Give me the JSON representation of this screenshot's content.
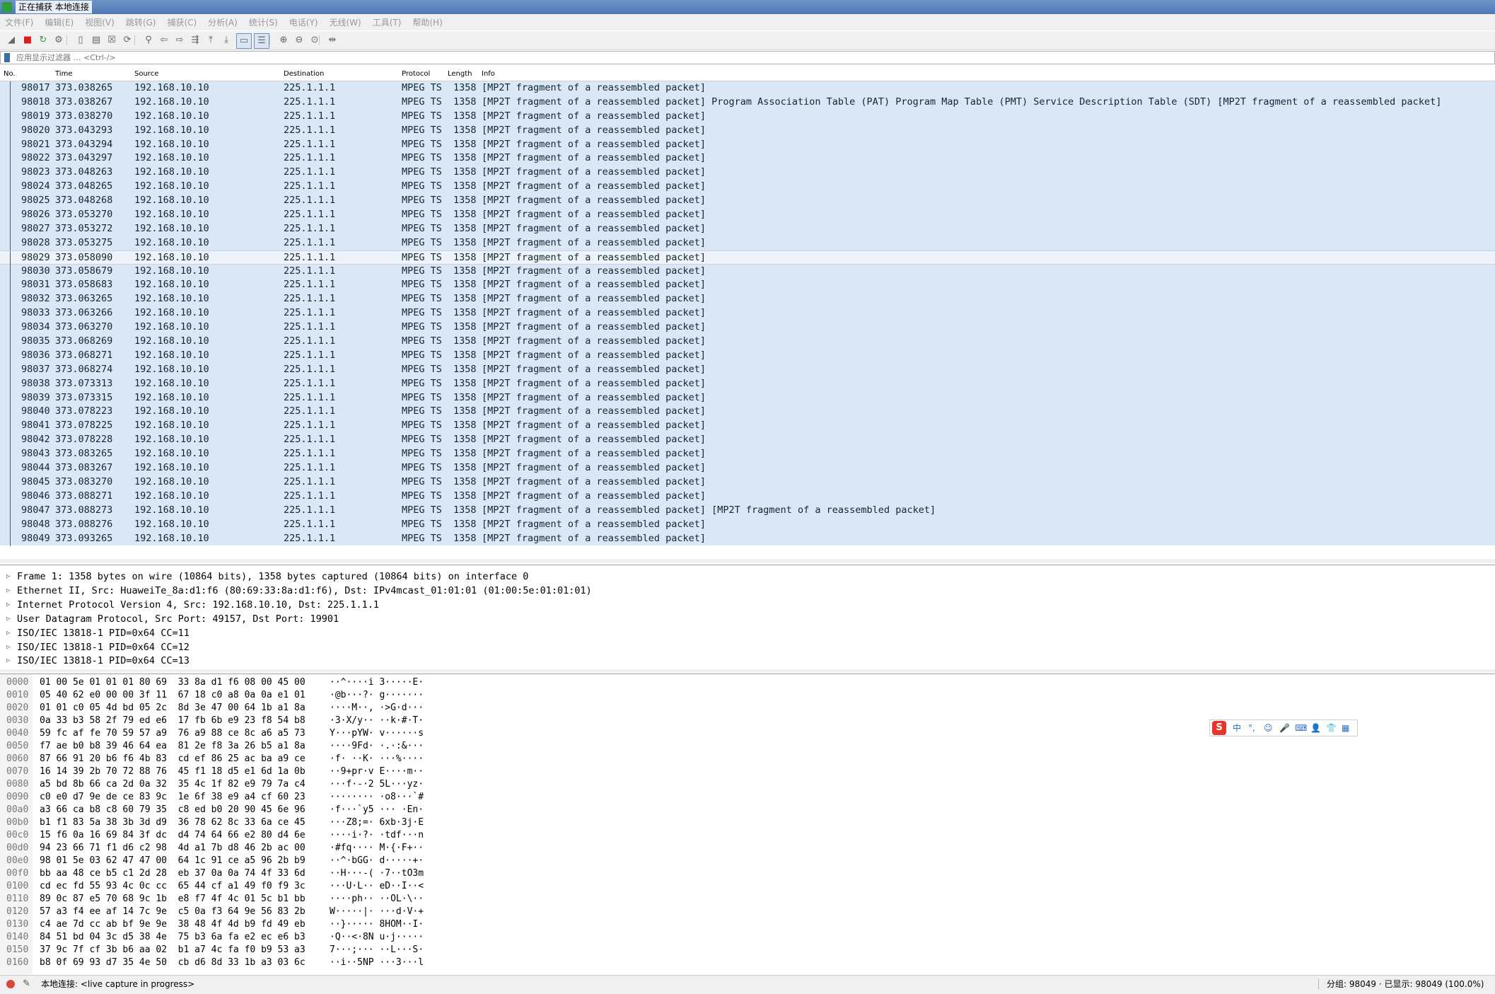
{
  "window": {
    "title": "正在捕获 本地连接"
  },
  "menu": [
    "文件(F)",
    "编辑(E)",
    "视图(V)",
    "跳转(G)",
    "捕获(C)",
    "分析(A)",
    "统计(S)",
    "电话(Y)",
    "无线(W)",
    "工具(T)",
    "帮助(H)"
  ],
  "toolbar": {
    "icons": [
      "shark-fin-start-icon",
      "stop-capture-icon",
      "restart-capture-icon",
      "capture-options-icon",
      "open-file-icon",
      "save-file-icon",
      "close-file-icon",
      "reload-file-icon",
      "find-packet-icon",
      "go-back-icon",
      "go-forward-icon",
      "go-to-packet-icon",
      "first-packet-icon",
      "last-packet-icon",
      "autoscroll-icon",
      "colorize-icon",
      "zoom-in-icon",
      "zoom-out-icon",
      "normal-size-icon",
      "resize-columns-icon"
    ],
    "glyphs": [
      "◢",
      "■",
      "↻",
      "⚙",
      "▯",
      "▤",
      "☒",
      "⟳",
      "⚲",
      "⇦",
      "⇨",
      "⇶",
      "⤒",
      "⤓",
      "▭",
      "☰",
      "⊕",
      "⊖",
      "⊙",
      "⇹"
    ]
  },
  "filter": {
    "placeholder": "应用显示过滤器 … <Ctrl-/>"
  },
  "columns": {
    "no": "No.",
    "time": "Time",
    "source": "Source",
    "destination": "Destination",
    "protocol": "Protocol",
    "length": "Length",
    "info": "Info"
  },
  "packets": [
    {
      "no": "98017",
      "time": "373.038265",
      "src": "192.168.10.10",
      "dst": "225.1.1.1",
      "proto": "MPEG TS",
      "len": "1358",
      "info": "[MP2T fragment of a reassembled packet]"
    },
    {
      "no": "98018",
      "time": "373.038267",
      "src": "192.168.10.10",
      "dst": "225.1.1.1",
      "proto": "MPEG TS",
      "len": "1358",
      "info": "[MP2T fragment of a reassembled packet] Program Association Table (PAT) Program Map Table (PMT) Service Description Table (SDT) [MP2T fragment of a reassembled packet]"
    },
    {
      "no": "98019",
      "time": "373.038270",
      "src": "192.168.10.10",
      "dst": "225.1.1.1",
      "proto": "MPEG TS",
      "len": "1358",
      "info": "[MP2T fragment of a reassembled packet]"
    },
    {
      "no": "98020",
      "time": "373.043293",
      "src": "192.168.10.10",
      "dst": "225.1.1.1",
      "proto": "MPEG TS",
      "len": "1358",
      "info": "[MP2T fragment of a reassembled packet]"
    },
    {
      "no": "98021",
      "time": "373.043294",
      "src": "192.168.10.10",
      "dst": "225.1.1.1",
      "proto": "MPEG TS",
      "len": "1358",
      "info": "[MP2T fragment of a reassembled packet]"
    },
    {
      "no": "98022",
      "time": "373.043297",
      "src": "192.168.10.10",
      "dst": "225.1.1.1",
      "proto": "MPEG TS",
      "len": "1358",
      "info": "[MP2T fragment of a reassembled packet]"
    },
    {
      "no": "98023",
      "time": "373.048263",
      "src": "192.168.10.10",
      "dst": "225.1.1.1",
      "proto": "MPEG TS",
      "len": "1358",
      "info": "[MP2T fragment of a reassembled packet]"
    },
    {
      "no": "98024",
      "time": "373.048265",
      "src": "192.168.10.10",
      "dst": "225.1.1.1",
      "proto": "MPEG TS",
      "len": "1358",
      "info": "[MP2T fragment of a reassembled packet]"
    },
    {
      "no": "98025",
      "time": "373.048268",
      "src": "192.168.10.10",
      "dst": "225.1.1.1",
      "proto": "MPEG TS",
      "len": "1358",
      "info": "[MP2T fragment of a reassembled packet]"
    },
    {
      "no": "98026",
      "time": "373.053270",
      "src": "192.168.10.10",
      "dst": "225.1.1.1",
      "proto": "MPEG TS",
      "len": "1358",
      "info": "[MP2T fragment of a reassembled packet]"
    },
    {
      "no": "98027",
      "time": "373.053272",
      "src": "192.168.10.10",
      "dst": "225.1.1.1",
      "proto": "MPEG TS",
      "len": "1358",
      "info": "[MP2T fragment of a reassembled packet]"
    },
    {
      "no": "98028",
      "time": "373.053275",
      "src": "192.168.10.10",
      "dst": "225.1.1.1",
      "proto": "MPEG TS",
      "len": "1358",
      "info": "[MP2T fragment of a reassembled packet]"
    },
    {
      "no": "98029",
      "time": "373.058090",
      "src": "192.168.10.10",
      "dst": "225.1.1.1",
      "proto": "MPEG TS",
      "len": "1358",
      "info": "[MP2T fragment of a reassembled packet]",
      "hover": true
    },
    {
      "no": "98030",
      "time": "373.058679",
      "src": "192.168.10.10",
      "dst": "225.1.1.1",
      "proto": "MPEG TS",
      "len": "1358",
      "info": "[MP2T fragment of a reassembled packet]"
    },
    {
      "no": "98031",
      "time": "373.058683",
      "src": "192.168.10.10",
      "dst": "225.1.1.1",
      "proto": "MPEG TS",
      "len": "1358",
      "info": "[MP2T fragment of a reassembled packet]"
    },
    {
      "no": "98032",
      "time": "373.063265",
      "src": "192.168.10.10",
      "dst": "225.1.1.1",
      "proto": "MPEG TS",
      "len": "1358",
      "info": "[MP2T fragment of a reassembled packet]"
    },
    {
      "no": "98033",
      "time": "373.063266",
      "src": "192.168.10.10",
      "dst": "225.1.1.1",
      "proto": "MPEG TS",
      "len": "1358",
      "info": "[MP2T fragment of a reassembled packet]"
    },
    {
      "no": "98034",
      "time": "373.063270",
      "src": "192.168.10.10",
      "dst": "225.1.1.1",
      "proto": "MPEG TS",
      "len": "1358",
      "info": "[MP2T fragment of a reassembled packet]"
    },
    {
      "no": "98035",
      "time": "373.068269",
      "src": "192.168.10.10",
      "dst": "225.1.1.1",
      "proto": "MPEG TS",
      "len": "1358",
      "info": "[MP2T fragment of a reassembled packet]"
    },
    {
      "no": "98036",
      "time": "373.068271",
      "src": "192.168.10.10",
      "dst": "225.1.1.1",
      "proto": "MPEG TS",
      "len": "1358",
      "info": "[MP2T fragment of a reassembled packet]"
    },
    {
      "no": "98037",
      "time": "373.068274",
      "src": "192.168.10.10",
      "dst": "225.1.1.1",
      "proto": "MPEG TS",
      "len": "1358",
      "info": "[MP2T fragment of a reassembled packet]"
    },
    {
      "no": "98038",
      "time": "373.073313",
      "src": "192.168.10.10",
      "dst": "225.1.1.1",
      "proto": "MPEG TS",
      "len": "1358",
      "info": "[MP2T fragment of a reassembled packet]"
    },
    {
      "no": "98039",
      "time": "373.073315",
      "src": "192.168.10.10",
      "dst": "225.1.1.1",
      "proto": "MPEG TS",
      "len": "1358",
      "info": "[MP2T fragment of a reassembled packet]"
    },
    {
      "no": "98040",
      "time": "373.078223",
      "src": "192.168.10.10",
      "dst": "225.1.1.1",
      "proto": "MPEG TS",
      "len": "1358",
      "info": "[MP2T fragment of a reassembled packet]"
    },
    {
      "no": "98041",
      "time": "373.078225",
      "src": "192.168.10.10",
      "dst": "225.1.1.1",
      "proto": "MPEG TS",
      "len": "1358",
      "info": "[MP2T fragment of a reassembled packet]"
    },
    {
      "no": "98042",
      "time": "373.078228",
      "src": "192.168.10.10",
      "dst": "225.1.1.1",
      "proto": "MPEG TS",
      "len": "1358",
      "info": "[MP2T fragment of a reassembled packet]"
    },
    {
      "no": "98043",
      "time": "373.083265",
      "src": "192.168.10.10",
      "dst": "225.1.1.1",
      "proto": "MPEG TS",
      "len": "1358",
      "info": "[MP2T fragment of a reassembled packet]"
    },
    {
      "no": "98044",
      "time": "373.083267",
      "src": "192.168.10.10",
      "dst": "225.1.1.1",
      "proto": "MPEG TS",
      "len": "1358",
      "info": "[MP2T fragment of a reassembled packet]"
    },
    {
      "no": "98045",
      "time": "373.083270",
      "src": "192.168.10.10",
      "dst": "225.1.1.1",
      "proto": "MPEG TS",
      "len": "1358",
      "info": "[MP2T fragment of a reassembled packet]"
    },
    {
      "no": "98046",
      "time": "373.088271",
      "src": "192.168.10.10",
      "dst": "225.1.1.1",
      "proto": "MPEG TS",
      "len": "1358",
      "info": "[MP2T fragment of a reassembled packet]"
    },
    {
      "no": "98047",
      "time": "373.088273",
      "src": "192.168.10.10",
      "dst": "225.1.1.1",
      "proto": "MPEG TS",
      "len": "1358",
      "info": "[MP2T fragment of a reassembled packet] [MP2T fragment of a reassembled packet]"
    },
    {
      "no": "98048",
      "time": "373.088276",
      "src": "192.168.10.10",
      "dst": "225.1.1.1",
      "proto": "MPEG TS",
      "len": "1358",
      "info": "[MP2T fragment of a reassembled packet]"
    },
    {
      "no": "98049",
      "time": "373.093265",
      "src": "192.168.10.10",
      "dst": "225.1.1.1",
      "proto": "MPEG TS",
      "len": "1358",
      "info": "[MP2T fragment of a reassembled packet]"
    }
  ],
  "details": [
    "Frame 1: 1358 bytes on wire (10864 bits), 1358 bytes captured (10864 bits) on interface 0",
    "Ethernet II, Src: HuaweiTe_8a:d1:f6 (80:69:33:8a:d1:f6), Dst: IPv4mcast_01:01:01 (01:00:5e:01:01:01)",
    "Internet Protocol Version 4, Src: 192.168.10.10, Dst: 225.1.1.1",
    "User Datagram Protocol, Src Port: 49157, Dst Port: 19901",
    "ISO/IEC 13818-1 PID=0x64 CC=11",
    "ISO/IEC 13818-1 PID=0x64 CC=12",
    "ISO/IEC 13818-1 PID=0x64 CC=13"
  ],
  "bytes": [
    {
      "off": "0000",
      "hex": "01 00 5e 01 01 01 80 69  33 8a d1 f6 08 00 45 00",
      "asc": "··^····i 3·····E·"
    },
    {
      "off": "0010",
      "hex": "05 40 62 e0 00 00 3f 11  67 18 c0 a8 0a 0a e1 01",
      "asc": "·@b···?· g·······"
    },
    {
      "off": "0020",
      "hex": "01 01 c0 05 4d bd 05 2c  8d 3e 47 00 64 1b a1 8a",
      "asc": "····M··, ·>G·d···"
    },
    {
      "off": "0030",
      "hex": "0a 33 b3 58 2f 79 ed e6  17 fb 6b e9 23 f8 54 b8",
      "asc": "·3·X/y·· ··k·#·T·"
    },
    {
      "off": "0040",
      "hex": "59 fc af fe 70 59 57 a9  76 a9 88 ce 8c a6 a5 73",
      "asc": "Y···pYW· v······s"
    },
    {
      "off": "0050",
      "hex": "f7 ae b0 b8 39 46 64 ea  81 2e f8 3a 26 b5 a1 8a",
      "asc": "····9Fd· ·.·:&···"
    },
    {
      "off": "0060",
      "hex": "87 66 91 20 b6 f6 4b 83  cd ef 86 25 ac ba a9 ce",
      "asc": "·f· ··K· ···%····"
    },
    {
      "off": "0070",
      "hex": "16 14 39 2b 70 72 88 76  45 f1 18 d5 e1 6d 1a 0b",
      "asc": "··9+pr·v E····m··"
    },
    {
      "off": "0080",
      "hex": "a5 bd 8b 66 ca 2d 0a 32  35 4c 1f 82 e9 79 7a c4",
      "asc": "···f·-·2 5L···yz·"
    },
    {
      "off": "0090",
      "hex": "c0 e0 d7 9e de ce 83 9c  1e 6f 38 e9 a4 cf 60 23",
      "asc": "········ ·o8···`#"
    },
    {
      "off": "00a0",
      "hex": "a3 66 ca b8 c8 60 79 35  c8 ed b0 20 90 45 6e 96",
      "asc": "·f···`y5 ··· ·En·"
    },
    {
      "off": "00b0",
      "hex": "b1 f1 83 5a 38 3b 3d d9  36 78 62 8c 33 6a ce 45",
      "asc": "···Z8;=· 6xb·3j·E"
    },
    {
      "off": "00c0",
      "hex": "15 f6 0a 16 69 84 3f dc  d4 74 64 66 e2 80 d4 6e",
      "asc": "····i·?· ·tdf···n"
    },
    {
      "off": "00d0",
      "hex": "94 23 66 71 f1 d6 c2 98  4d a1 7b d8 46 2b ac 00",
      "asc": "·#fq···· M·{·F+··"
    },
    {
      "off": "00e0",
      "hex": "98 01 5e 03 62 47 47 00  64 1c 91 ce a5 96 2b b9",
      "asc": "··^·bGG· d·····+·"
    },
    {
      "off": "00f0",
      "hex": "bb aa 48 ce b5 c1 2d 28  eb 37 0a 0a 74 4f 33 6d",
      "asc": "··H···-( ·7··tO3m"
    },
    {
      "off": "0100",
      "hex": "cd ec fd 55 93 4c 0c cc  65 44 cf a1 49 f0 f9 3c",
      "asc": "···U·L·· eD··I··<"
    },
    {
      "off": "0110",
      "hex": "89 0c 87 e5 70 68 9c 1b  e8 f7 4f 4c 01 5c b1 bb",
      "asc": "····ph·· ··OL·\\··"
    },
    {
      "off": "0120",
      "hex": "57 a3 f4 ee af 14 7c 9e  c5 0a f3 64 9e 56 83 2b",
      "asc": "W·····|· ···d·V·+"
    },
    {
      "off": "0130",
      "hex": "c4 ae 7d cc ab bf 9e 9e  38 48 4f 4d b9 fd 49 eb",
      "asc": "··}····· 8HOM··I·"
    },
    {
      "off": "0140",
      "hex": "84 51 bd 04 3c d5 38 4e  75 b3 6a fa e2 ec e6 b3",
      "asc": "·Q··<·8N u·j·····"
    },
    {
      "off": "0150",
      "hex": "37 9c 7f cf 3b b6 aa 02  b1 a7 4c fa f0 b9 53 a3",
      "asc": "7···;··· ··L···S·"
    },
    {
      "off": "0160",
      "hex": "b8 0f 69 93 d7 35 4e 50  cb d6 8d 33 1b a3 03 6c",
      "asc": "··i··5NP ···3···l"
    }
  ],
  "ime": {
    "logo": "S",
    "items": [
      "中",
      "°,",
      "☺",
      "🎤",
      "⌨",
      "👤",
      "👕",
      "▦"
    ]
  },
  "status": {
    "edit_glyph": "✎",
    "capture": "本地连接: <live capture in progress>",
    "right": "分组: 98049 · 已显示: 98049 (100.0%)"
  },
  "colors": {
    "row_bg": "#dae7f6",
    "row_hover_bg": "#eef3f9",
    "titlebar": "#4f78b4",
    "record": "#d9463f"
  }
}
